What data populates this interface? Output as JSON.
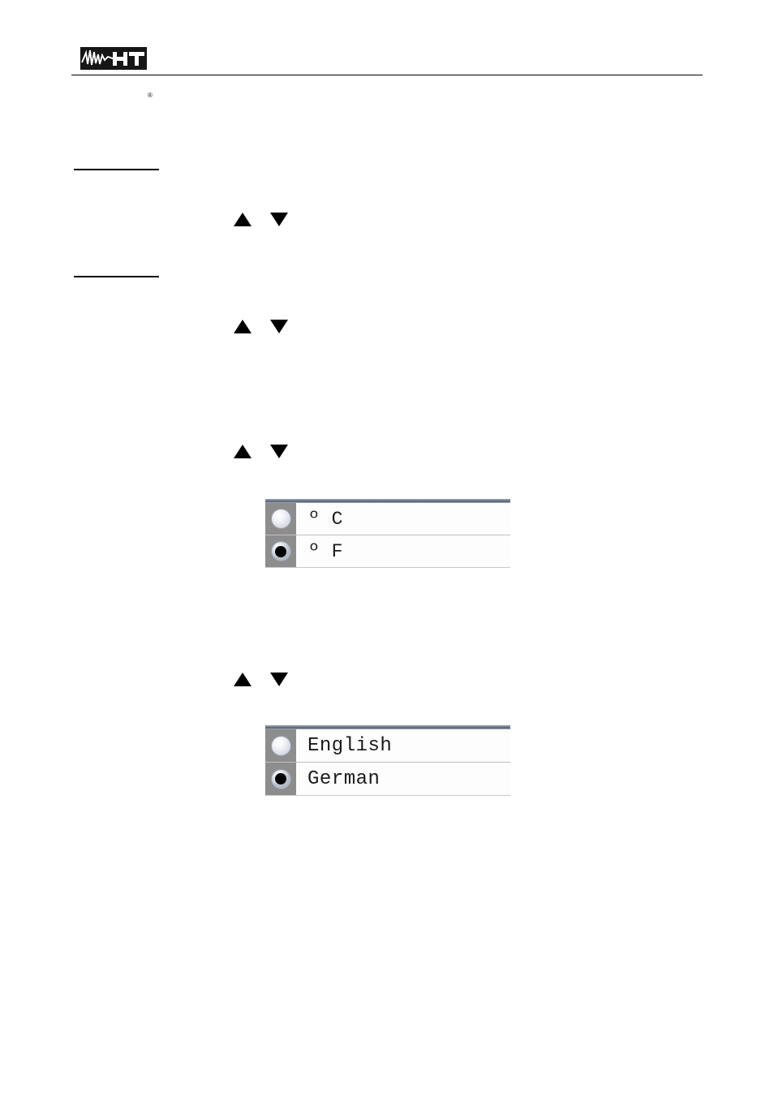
{
  "document": {
    "brand": {
      "logo_text": "HT",
      "registered_mark": "®",
      "logo_icon": "ht-waveform-logo"
    }
  },
  "sections": [
    {
      "id": "section-1",
      "heading_rule": true,
      "keys": {
        "up": "▲",
        "down": "▼"
      }
    },
    {
      "id": "section-2",
      "heading_rule": true,
      "keys": {
        "up": "▲",
        "down": "▼"
      }
    }
  ],
  "key_hints": [
    {
      "id": "key-hint-1",
      "up": "▲",
      "down": "▼"
    },
    {
      "id": "key-hint-2",
      "up": "▲",
      "down": "▼"
    },
    {
      "id": "key-hint-3",
      "up": "▲",
      "down": "▼"
    },
    {
      "id": "key-hint-4",
      "up": "▲",
      "down": "▼"
    }
  ],
  "temperature_list": {
    "name": "temperature-unit-list",
    "options": [
      {
        "label": "º C",
        "selected": false
      },
      {
        "label": "º F",
        "selected": true
      }
    ]
  },
  "language_list": {
    "name": "language-list",
    "options": [
      {
        "label": "English",
        "selected": false
      },
      {
        "label": "German",
        "selected": true
      }
    ]
  },
  "colors": {
    "listbox_topbar": "#4f5a6b",
    "radio_cell_bg": "#8d8d8d",
    "row_border": "#bfbfbf",
    "text": "#1a1a1a",
    "rule": "#000000",
    "logo_bg": "#161616"
  }
}
